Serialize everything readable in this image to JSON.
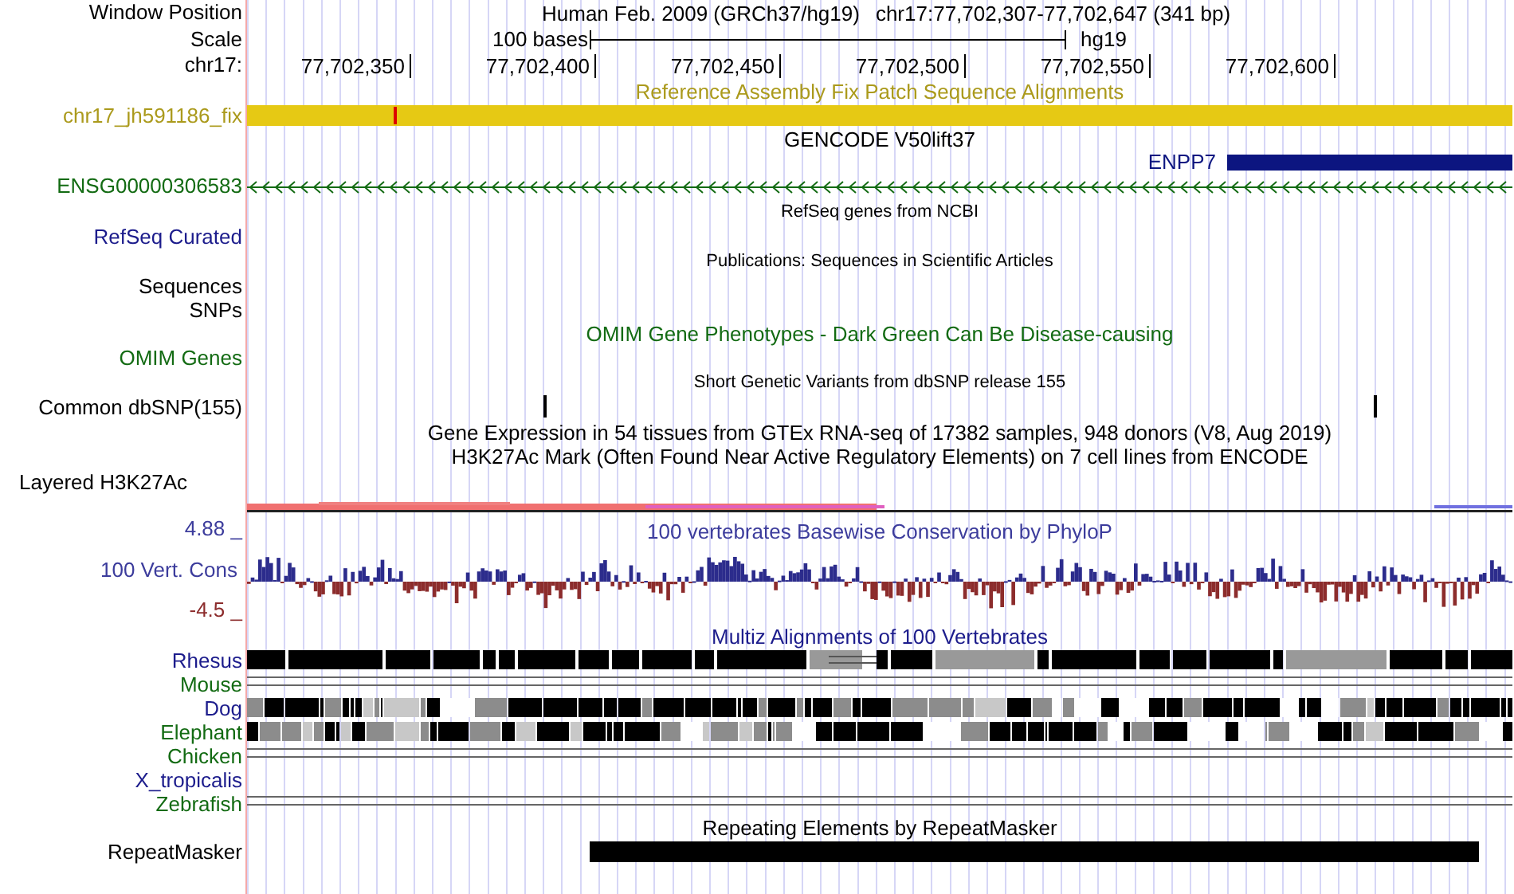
{
  "rows": [
    {
      "kind": "position",
      "label": "Window Position",
      "assembly_text": "Human Feb. 2009 (GRCh37/hg19)",
      "range_text": "chr17:77,702,307-77,702,647 (341 bp)"
    },
    {
      "kind": "scale",
      "label": "Scale",
      "bar_text": "100 bases",
      "assembly": "hg19"
    },
    {
      "kind": "ruler",
      "label": "chr17:",
      "ticks": [
        "77,702,350",
        "77,702,400",
        "77,702,450",
        "77,702,500",
        "77,702,550",
        "77,702,600"
      ]
    },
    {
      "kind": "title",
      "text": "Reference Assembly Fix Patch Sequence Alignments",
      "color": "#ab9a1c"
    },
    {
      "kind": "fix_patch",
      "label": "chr17_jh591186_fix",
      "color": "#ab9a1c"
    },
    {
      "kind": "title",
      "text": "GENCODE V50lift37",
      "color": "#000000"
    },
    {
      "kind": "gene",
      "name": "ENPP7",
      "color": "#0c1580"
    },
    {
      "kind": "strand",
      "label": "ENSG00000306583",
      "color": "#136b13"
    },
    {
      "kind": "small_title",
      "text": "RefSeq genes from NCBI"
    },
    {
      "kind": "label",
      "label": "RefSeq Curated",
      "color": "#1c1c8c"
    },
    {
      "kind": "small_title",
      "text": "Publications: Sequences in Scientific Articles"
    },
    {
      "kind": "label",
      "label": "Sequences",
      "color": "#000000"
    },
    {
      "kind": "label",
      "label": "SNPs",
      "color": "#000000"
    },
    {
      "kind": "title",
      "text": "OMIM Gene Phenotypes - Dark Green Can Be Disease-causing",
      "color": "#136b13"
    },
    {
      "kind": "label",
      "label": "OMIM Genes",
      "color": "#136b13"
    },
    {
      "kind": "small_title",
      "text": "Short Genetic Variants from dbSNP release 155"
    },
    {
      "kind": "snps",
      "label": "Common dbSNP(155)",
      "color": "#000000"
    },
    {
      "kind": "title",
      "text": "Gene Expression in 54 tissues from GTEx RNA-seq of 17382 samples, 948 donors (V8, Aug 2019)",
      "color": "#000000"
    },
    {
      "kind": "title",
      "text": "H3K27Ac Mark (Often Found Near Active Regulatory Elements) on 7 cell lines from ENCODE",
      "color": "#000000"
    },
    {
      "kind": "layered",
      "label": "Layered H3K27Ac",
      "color": "#000000"
    },
    {
      "kind": "phylop",
      "max_label": "4.88 _",
      "title": "100 vertebrates Basewise Conservation by PhyloP",
      "label": "100 Vert. Cons",
      "min_label": "-4.5 _"
    },
    {
      "kind": "title",
      "text": "Multiz Alignments of 100 Vertebrates",
      "color": "#1c1c8c"
    },
    {
      "kind": "blocks",
      "label": "Rhesus",
      "color": "#1c1c8c"
    },
    {
      "kind": "gap",
      "label": "Mouse",
      "color": "#136b13"
    },
    {
      "kind": "mixed",
      "label": "Dog",
      "color": "#1c1c8c"
    },
    {
      "kind": "mixed",
      "label": "Elephant",
      "color": "#136b13"
    },
    {
      "kind": "gap",
      "label": "Chicken",
      "color": "#136b13"
    },
    {
      "kind": "empty",
      "label": "X_tropicalis",
      "color": "#1c1c8c"
    },
    {
      "kind": "gap",
      "label": "Zebrafish",
      "color": "#136b13"
    },
    {
      "kind": "title",
      "text": "Repeating Elements by RepeatMasker",
      "color": "#000000"
    },
    {
      "kind": "repeat",
      "label": "RepeatMasker",
      "color": "#000000"
    }
  ]
}
